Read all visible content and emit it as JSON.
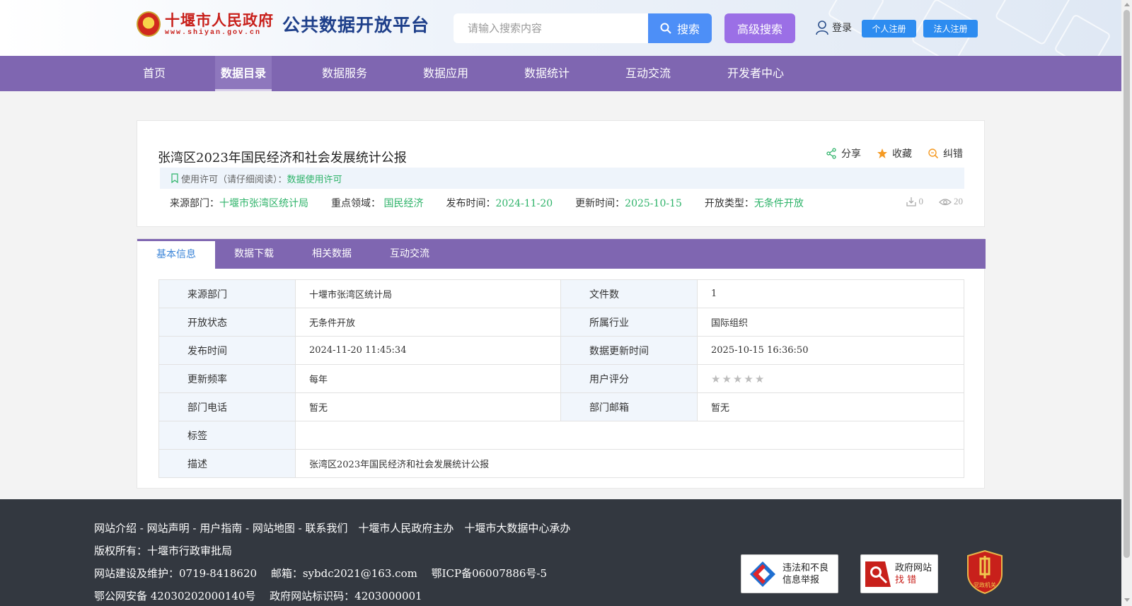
{
  "header": {
    "logo_text": "十堰市人民政府",
    "logo_url": "www.shiyan.gov.cn",
    "platform_title": "公共数据开放平台",
    "search_placeholder": "请输入搜索内容",
    "search_label": "搜索",
    "advanced_label": "高级搜索",
    "login_label": "登录",
    "personal_register": "个人注册",
    "corporate_register": "法人注册"
  },
  "nav": {
    "items": [
      {
        "label": "首页"
      },
      {
        "label": "数据目录",
        "active": true
      },
      {
        "label": "数据服务"
      },
      {
        "label": "数据应用"
      },
      {
        "label": "数据统计"
      },
      {
        "label": "互动交流"
      },
      {
        "label": "开发者中心"
      }
    ]
  },
  "dataset": {
    "title": "张湾区2023年国民经济和社会发展统计公报",
    "actions": {
      "share": "分享",
      "favorite": "收藏",
      "correct": "纠错"
    },
    "license_prefix": "使用许可（请仔细阅读）：",
    "license_link": "数据使用许可",
    "meta": {
      "source_label": "来源部门：",
      "source": "十堰市张湾区统计局",
      "domain_label": "重点领域：",
      "domain": "国民经济",
      "publish_label": "发布时间：",
      "publish": "2024-11-20",
      "update_label": "更新时间：",
      "update": "2025-10-15",
      "open_label": "开放类型：",
      "open": "无条件开放"
    },
    "downloads": "0",
    "views": "20"
  },
  "tabs": [
    "基本信息",
    "数据下载",
    "相关数据",
    "互动交流"
  ],
  "info_table": {
    "source_dept_k": "来源部门",
    "source_dept_v": "十堰市张湾区统计局",
    "file_count_k": "文件数",
    "file_count_v": "1",
    "open_status_k": "开放状态",
    "open_status_v": "无条件开放",
    "industry_k": "所属行业",
    "industry_v": "国际组织",
    "publish_time_k": "发布时间",
    "publish_time_v": "2024-11-20 11:45:34",
    "update_time_k": "数据更新时间",
    "update_time_v": "2025-10-15 16:36:50",
    "frequency_k": "更新频率",
    "frequency_v": "每年",
    "rating_k": "用户评分",
    "rating_value": 0,
    "rating_max": 5,
    "phone_k": "部门电话",
    "phone_v": "暂无",
    "email_k": "部门邮箱",
    "email_v": "暂无",
    "tags_k": "标签",
    "tags_v": "",
    "desc_k": "描述",
    "desc_v": "张湾区2023年国民经济和社会发展统计公报"
  },
  "footer": {
    "links_line": "网站介绍 - 网站声明 - 用户指南 - 网站地图 - 联系我们　十堰市人民政府主办　十堰市大数据中心承办",
    "copyright": "版权所有：十堰市行政审批局",
    "maintain": "网站建设及维护：0719-8418620　 邮箱：sybdc2021@163.com　 鄂ICP备06007886号-5",
    "security": "鄂公网安备 42030202000140号　 政府网站标识码：4203000001",
    "badge1_line1": "违法和不良",
    "badge1_line2": "信息举报",
    "badge2_line1": "政府网站",
    "badge2_line2": "找 错",
    "party_label": "党政机关"
  }
}
